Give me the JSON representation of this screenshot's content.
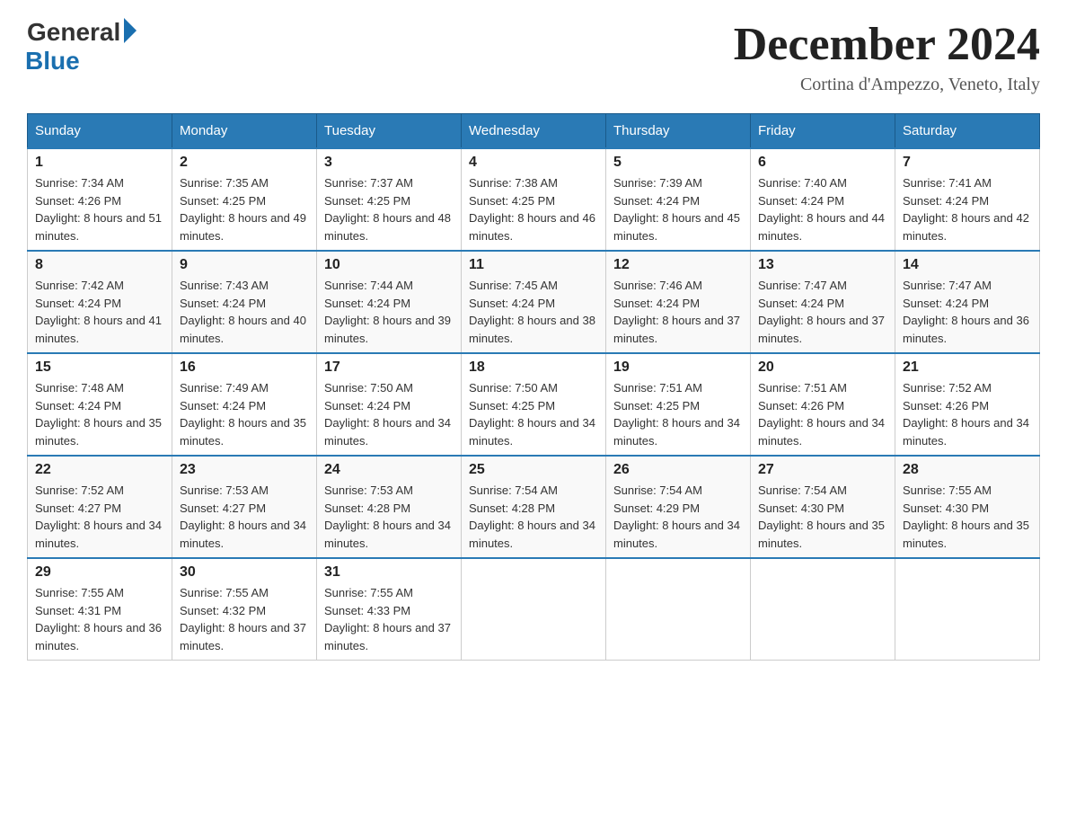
{
  "header": {
    "logo_general": "General",
    "logo_blue": "Blue",
    "month_title": "December 2024",
    "location": "Cortina d'Ampezzo, Veneto, Italy"
  },
  "days_of_week": [
    "Sunday",
    "Monday",
    "Tuesday",
    "Wednesday",
    "Thursday",
    "Friday",
    "Saturday"
  ],
  "weeks": [
    [
      {
        "day": "1",
        "sunrise": "7:34 AM",
        "sunset": "4:26 PM",
        "daylight": "8 hours and 51 minutes."
      },
      {
        "day": "2",
        "sunrise": "7:35 AM",
        "sunset": "4:25 PM",
        "daylight": "8 hours and 49 minutes."
      },
      {
        "day": "3",
        "sunrise": "7:37 AM",
        "sunset": "4:25 PM",
        "daylight": "8 hours and 48 minutes."
      },
      {
        "day": "4",
        "sunrise": "7:38 AM",
        "sunset": "4:25 PM",
        "daylight": "8 hours and 46 minutes."
      },
      {
        "day": "5",
        "sunrise": "7:39 AM",
        "sunset": "4:24 PM",
        "daylight": "8 hours and 45 minutes."
      },
      {
        "day": "6",
        "sunrise": "7:40 AM",
        "sunset": "4:24 PM",
        "daylight": "8 hours and 44 minutes."
      },
      {
        "day": "7",
        "sunrise": "7:41 AM",
        "sunset": "4:24 PM",
        "daylight": "8 hours and 42 minutes."
      }
    ],
    [
      {
        "day": "8",
        "sunrise": "7:42 AM",
        "sunset": "4:24 PM",
        "daylight": "8 hours and 41 minutes."
      },
      {
        "day": "9",
        "sunrise": "7:43 AM",
        "sunset": "4:24 PM",
        "daylight": "8 hours and 40 minutes."
      },
      {
        "day": "10",
        "sunrise": "7:44 AM",
        "sunset": "4:24 PM",
        "daylight": "8 hours and 39 minutes."
      },
      {
        "day": "11",
        "sunrise": "7:45 AM",
        "sunset": "4:24 PM",
        "daylight": "8 hours and 38 minutes."
      },
      {
        "day": "12",
        "sunrise": "7:46 AM",
        "sunset": "4:24 PM",
        "daylight": "8 hours and 37 minutes."
      },
      {
        "day": "13",
        "sunrise": "7:47 AM",
        "sunset": "4:24 PM",
        "daylight": "8 hours and 37 minutes."
      },
      {
        "day": "14",
        "sunrise": "7:47 AM",
        "sunset": "4:24 PM",
        "daylight": "8 hours and 36 minutes."
      }
    ],
    [
      {
        "day": "15",
        "sunrise": "7:48 AM",
        "sunset": "4:24 PM",
        "daylight": "8 hours and 35 minutes."
      },
      {
        "day": "16",
        "sunrise": "7:49 AM",
        "sunset": "4:24 PM",
        "daylight": "8 hours and 35 minutes."
      },
      {
        "day": "17",
        "sunrise": "7:50 AM",
        "sunset": "4:24 PM",
        "daylight": "8 hours and 34 minutes."
      },
      {
        "day": "18",
        "sunrise": "7:50 AM",
        "sunset": "4:25 PM",
        "daylight": "8 hours and 34 minutes."
      },
      {
        "day": "19",
        "sunrise": "7:51 AM",
        "sunset": "4:25 PM",
        "daylight": "8 hours and 34 minutes."
      },
      {
        "day": "20",
        "sunrise": "7:51 AM",
        "sunset": "4:26 PM",
        "daylight": "8 hours and 34 minutes."
      },
      {
        "day": "21",
        "sunrise": "7:52 AM",
        "sunset": "4:26 PM",
        "daylight": "8 hours and 34 minutes."
      }
    ],
    [
      {
        "day": "22",
        "sunrise": "7:52 AM",
        "sunset": "4:27 PM",
        "daylight": "8 hours and 34 minutes."
      },
      {
        "day": "23",
        "sunrise": "7:53 AM",
        "sunset": "4:27 PM",
        "daylight": "8 hours and 34 minutes."
      },
      {
        "day": "24",
        "sunrise": "7:53 AM",
        "sunset": "4:28 PM",
        "daylight": "8 hours and 34 minutes."
      },
      {
        "day": "25",
        "sunrise": "7:54 AM",
        "sunset": "4:28 PM",
        "daylight": "8 hours and 34 minutes."
      },
      {
        "day": "26",
        "sunrise": "7:54 AM",
        "sunset": "4:29 PM",
        "daylight": "8 hours and 34 minutes."
      },
      {
        "day": "27",
        "sunrise": "7:54 AM",
        "sunset": "4:30 PM",
        "daylight": "8 hours and 35 minutes."
      },
      {
        "day": "28",
        "sunrise": "7:55 AM",
        "sunset": "4:30 PM",
        "daylight": "8 hours and 35 minutes."
      }
    ],
    [
      {
        "day": "29",
        "sunrise": "7:55 AM",
        "sunset": "4:31 PM",
        "daylight": "8 hours and 36 minutes."
      },
      {
        "day": "30",
        "sunrise": "7:55 AM",
        "sunset": "4:32 PM",
        "daylight": "8 hours and 37 minutes."
      },
      {
        "day": "31",
        "sunrise": "7:55 AM",
        "sunset": "4:33 PM",
        "daylight": "8 hours and 37 minutes."
      },
      null,
      null,
      null,
      null
    ]
  ]
}
